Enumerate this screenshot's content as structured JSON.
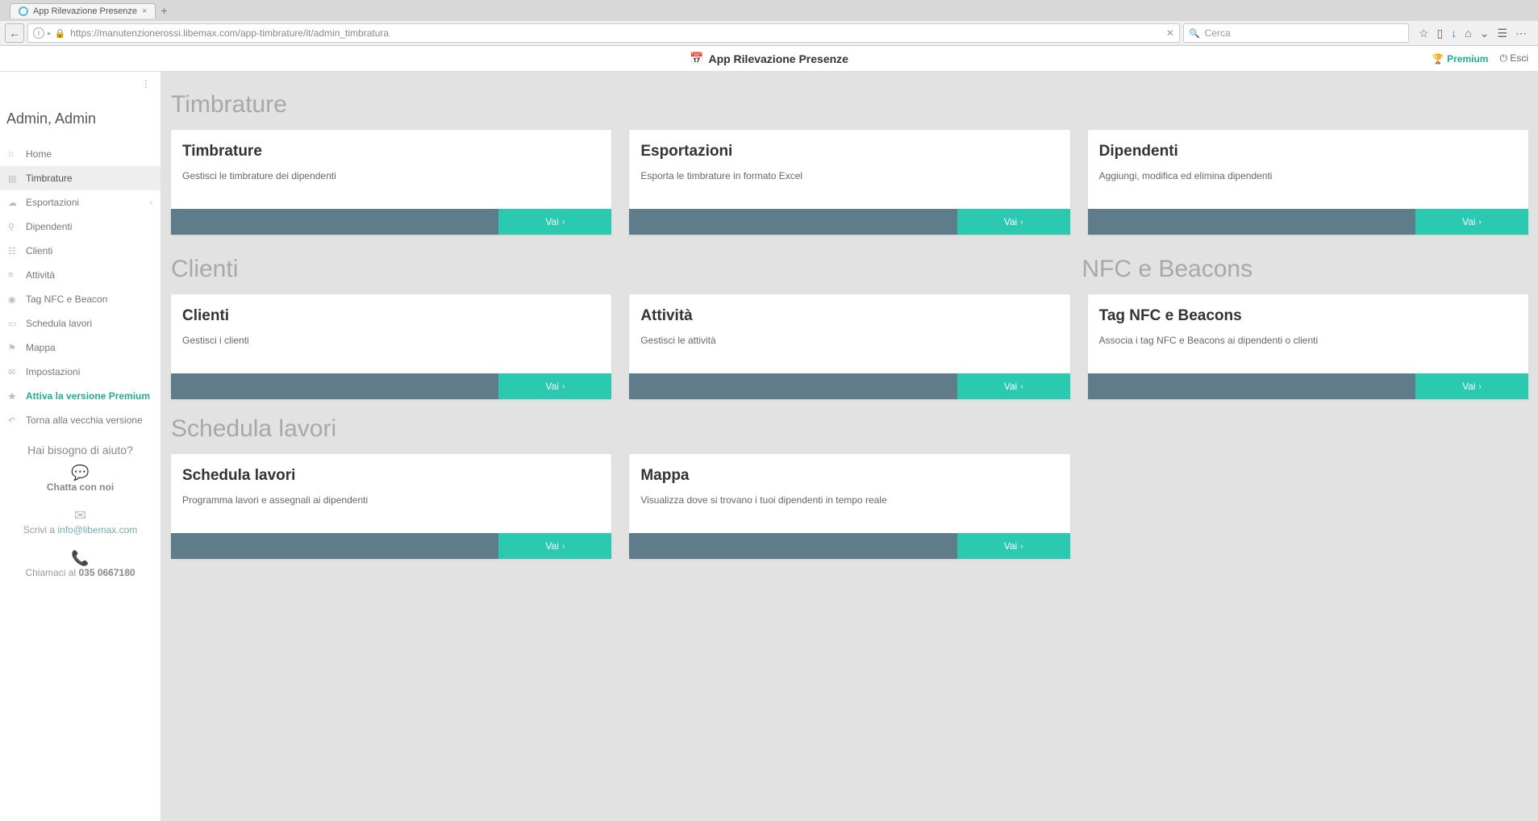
{
  "browser": {
    "tab_title": "App Rilevazione Presenze",
    "url": "https://manutenzionerossi.libemax.com/app-timbrature/it/admin_timbratura",
    "search_placeholder": "Cerca"
  },
  "header": {
    "app_title": "App Rilevazione Presenze",
    "premium_label": "Premium",
    "exit_label": "Esci"
  },
  "sidebar": {
    "user": "Admin, Admin",
    "items": [
      {
        "icon": "⌂",
        "label": "Home",
        "active": false
      },
      {
        "icon": "▤",
        "label": "Timbrature",
        "active": true
      },
      {
        "icon": "☁",
        "label": "Esportazioni",
        "active": false,
        "expandable": true
      },
      {
        "icon": "⚲",
        "label": "Dipendenti",
        "active": false
      },
      {
        "icon": "☷",
        "label": "Clienti",
        "active": false
      },
      {
        "icon": "≡",
        "label": "Attività",
        "active": false
      },
      {
        "icon": "◉",
        "label": "Tag NFC e Beacon",
        "active": false
      },
      {
        "icon": "▭",
        "label": "Schedula lavori",
        "active": false
      },
      {
        "icon": "⚑",
        "label": "Mappa",
        "active": false
      },
      {
        "icon": "✉",
        "label": "Impostazioni",
        "active": false
      },
      {
        "icon": "★",
        "label": "Attiva la versione Premium",
        "active": false,
        "premium": true
      },
      {
        "icon": "↶",
        "label": "Torna alla vecchia versione",
        "active": false
      }
    ],
    "help": {
      "title": "Hai bisogno di aiuto?",
      "chat_label": "Chatta con noi",
      "email_prefix": "Scrivi a ",
      "email": "info@libemax.com",
      "phone_prefix": "Chiamaci al ",
      "phone": "035 0667180"
    }
  },
  "sections": {
    "timbrature": {
      "title": "Timbrature",
      "cards": [
        {
          "title": "Timbrature",
          "desc": "Gestisci le timbrature dei dipendenti",
          "btn": "Vai"
        },
        {
          "title": "Esportazioni",
          "desc": "Esporta le timbrature in formato Excel",
          "btn": "Vai"
        },
        {
          "title": "Dipendenti",
          "desc": "Aggiungi, modifica ed elimina dipendenti",
          "btn": "Vai"
        }
      ]
    },
    "clienti": {
      "title": "Clienti",
      "cards": [
        {
          "title": "Clienti",
          "desc": "Gestisci i clienti",
          "btn": "Vai"
        },
        {
          "title": "Attività",
          "desc": "Gestisci le attività",
          "btn": "Vai"
        }
      ]
    },
    "nfc": {
      "title": "NFC e Beacons",
      "cards": [
        {
          "title": "Tag NFC e Beacons",
          "desc": "Associa i tag NFC e Beacons ai dipendenti o clienti",
          "btn": "Vai"
        }
      ]
    },
    "schedula": {
      "title": "Schedula lavori",
      "cards": [
        {
          "title": "Schedula lavori",
          "desc": "Programma lavori e assegnali ai dipendenti",
          "btn": "Vai"
        },
        {
          "title": "Mappa",
          "desc": "Visualizza dove si trovano i tuoi dipendenti in tempo reale",
          "btn": "Vai"
        }
      ]
    }
  }
}
